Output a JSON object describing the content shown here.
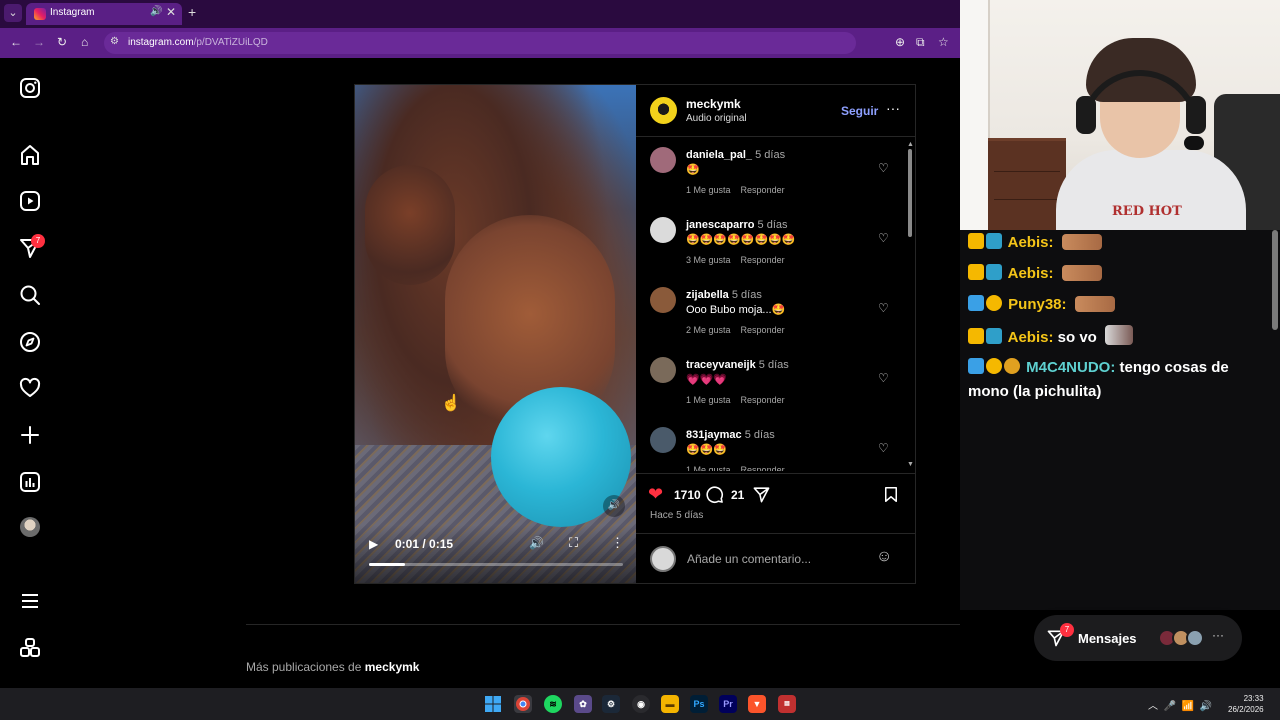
{
  "browser": {
    "tab_title": "Instagram",
    "tab_audio_icon": "🔊",
    "tab_close": "✕",
    "new_tab": "+",
    "tab_menu": "⌄",
    "url_host": "instagram.com",
    "url_path": "/p/DVATiZUiLQD",
    "nav": {
      "back": "←",
      "forward": "→",
      "reload": "↻",
      "home": "⌂",
      "site_info": "⚙"
    },
    "right": {
      "zoom": "⊕",
      "install": "⧉",
      "bookmark": "☆"
    }
  },
  "sidebar": {
    "notifications_badge": "7"
  },
  "post": {
    "author": "meckymk",
    "subtitle": "Audio original",
    "follow_label": "Seguir",
    "more_label": "···",
    "video": {
      "time": "0:01 / 0:15",
      "progress": 0.14
    },
    "comments": [
      {
        "user": "daniela_pal_",
        "age": "5 días",
        "text": "🤩",
        "likes": "1 Me gusta",
        "reply": "Responder",
        "avatar_color": "#a06a7a"
      },
      {
        "user": "janescaparro",
        "age": "5 días",
        "text": "🤩🤩🤩🤩🤩🤩🤩🤩",
        "likes": "3 Me gusta",
        "reply": "Responder",
        "avatar_color": "#dbdbdb"
      },
      {
        "user": "zijabella",
        "age": "5 días",
        "text": "Ooo Bubo moja...🤩",
        "likes": "2 Me gusta",
        "reply": "Responder",
        "avatar_color": "#8a5a3a"
      },
      {
        "user": "traceyvaneijk",
        "age": "5 días",
        "text": "💗💗💗",
        "likes": "1 Me gusta",
        "reply": "Responder",
        "avatar_color": "#7a6a5a"
      },
      {
        "user": "831jaymac",
        "age": "5 días",
        "text": "🤩🤩🤩",
        "likes": "1 Me gusta",
        "reply": "Responder",
        "avatar_color": "#4a5a6a"
      }
    ],
    "likes_count": "1710",
    "comments_count": "21",
    "posted": "Hace 5 días",
    "add_comment_placeholder": "Añade un comentario...",
    "heart_icon": "♡"
  },
  "more_posts": {
    "prefix": "Más publicaciones de",
    "author": "meckymk"
  },
  "chat": [
    {
      "user": "Aebis:",
      "message": ""
    },
    {
      "user": "Aebis:",
      "message": ""
    },
    {
      "user": "Puny38:",
      "message": ""
    },
    {
      "user": "Aebis:",
      "message": "so vo"
    },
    {
      "user": "M4C4NUDO:",
      "message": "tengo cosas de mono (la pichulita)"
    }
  ],
  "webcam": {
    "shirt_text": "RED HOT"
  },
  "messages_pill": {
    "label": "Mensajes",
    "badge": "7"
  },
  "taskbar": {
    "time": "23:33",
    "date": "26/2/2026"
  }
}
